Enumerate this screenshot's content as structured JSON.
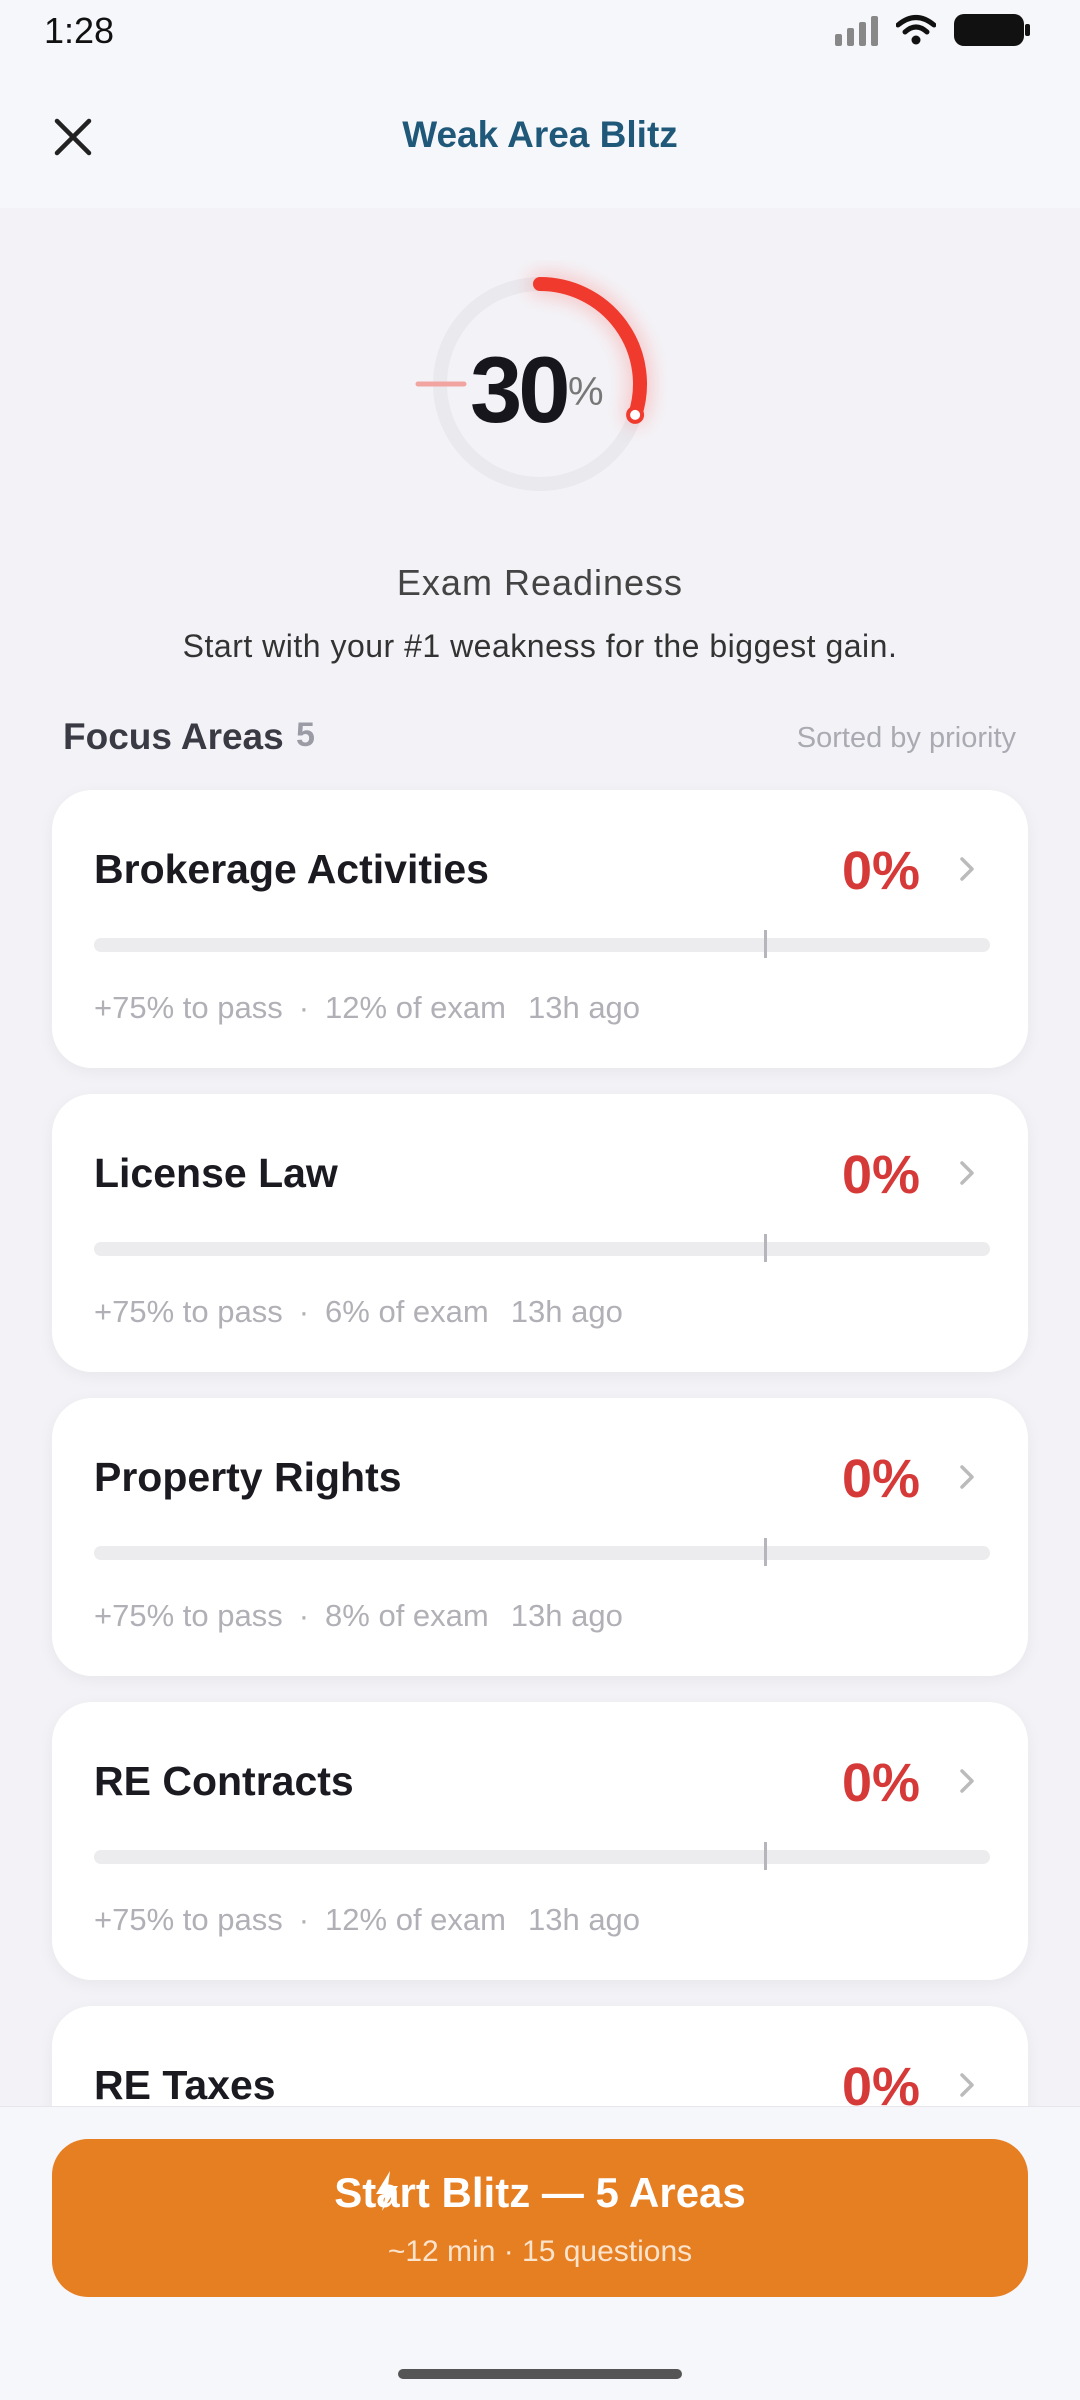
{
  "status": {
    "time": "1:28"
  },
  "header": {
    "title": "Weak Area Blitz"
  },
  "readiness": {
    "value": "30",
    "unit": "%",
    "fraction": 0.3,
    "label": "Exam Readiness",
    "subtitle": "Start with your #1 weakness for the biggest gain."
  },
  "focus": {
    "title": "Focus Areas",
    "count": "5",
    "sort_label": "Sorted by priority"
  },
  "areas": [
    {
      "name": "Brokerage Activities",
      "percent": "0%",
      "progress": 0,
      "to_pass": "+75% to pass",
      "exam_share": "12% of exam",
      "updated": "13h ago"
    },
    {
      "name": "License Law",
      "percent": "0%",
      "progress": 0,
      "to_pass": "+75% to pass",
      "exam_share": "6% of exam",
      "updated": "13h ago"
    },
    {
      "name": "Property Rights",
      "percent": "0%",
      "progress": 0,
      "to_pass": "+75% to pass",
      "exam_share": "8% of exam",
      "updated": "13h ago"
    },
    {
      "name": "RE Contracts",
      "percent": "0%",
      "progress": 0,
      "to_pass": "+75% to pass",
      "exam_share": "12% of exam",
      "updated": "13h ago"
    },
    {
      "name": "RE Taxes",
      "percent": "0%",
      "progress": 0,
      "to_pass": "",
      "exam_share": "",
      "updated": ""
    }
  ],
  "meta_separator": "·",
  "cta": {
    "label": "Start Blitz — 5 Areas",
    "sub": "~12 min · 15 questions"
  },
  "colors": {
    "accent": "#e67e22",
    "danger": "#d63a38",
    "title": "#1f5878"
  }
}
